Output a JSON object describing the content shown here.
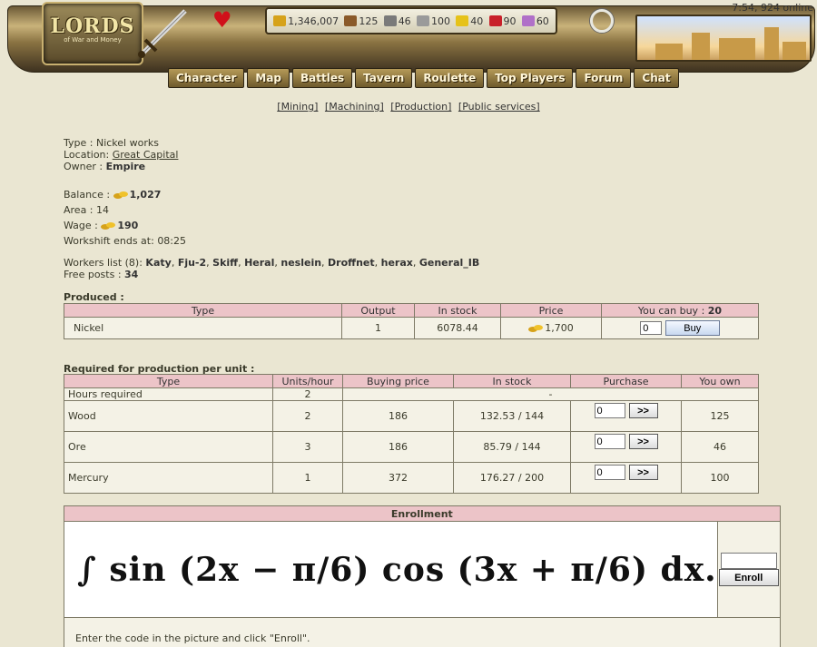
{
  "header": {
    "logo_title": "LORDS",
    "logo_subtitle": "of War and Money",
    "clock": "7:54, 924 online",
    "resources": [
      {
        "icon": "gold-icon",
        "value": "1,346,007",
        "color": "#d6a21a"
      },
      {
        "icon": "wood-icon",
        "value": "125",
        "color": "#8a5a2a"
      },
      {
        "icon": "ore-icon",
        "value": "46",
        "color": "#7a7a7a"
      },
      {
        "icon": "mercury-icon",
        "value": "100",
        "color": "#9a9a9a"
      },
      {
        "icon": "sulfur-icon",
        "value": "40",
        "color": "#e6c21a"
      },
      {
        "icon": "crystal-icon",
        "value": "90",
        "color": "#c8202a"
      },
      {
        "icon": "gems-icon",
        "value": "60",
        "color": "#b070c8"
      }
    ],
    "nav": [
      "Character",
      "Map",
      "Battles",
      "Tavern",
      "Roulette",
      "Top Players",
      "Forum",
      "Chat"
    ]
  },
  "subnav": [
    "[Mining]",
    "[Machining]",
    "[Production]",
    "[Public services]"
  ],
  "info": {
    "type_label": "Type : ",
    "type": "Nickel works",
    "location_label": "Location: ",
    "location": "Great Capital",
    "owner_label": "Owner : ",
    "owner": "Empire",
    "balance_label": "Balance : ",
    "balance": "1,027",
    "area_label": "Area : ",
    "area": "14",
    "wage_label": "Wage : ",
    "wage": "190",
    "workshift_label": "Workshift ends at: ",
    "workshift": "08:25",
    "workers_label": "Workers list (8): ",
    "workers": [
      "Katy",
      "Fju-2",
      "Skiff",
      "Heral",
      "neslein",
      "Droffnet",
      "herax",
      "General_IB"
    ],
    "free_posts_label": "Free posts : ",
    "free_posts": "34"
  },
  "produced": {
    "title": "Produced :",
    "headers": [
      "Type",
      "Output",
      "In stock",
      "Price",
      "You can buy : "
    ],
    "can_buy": "20",
    "row": {
      "type": "Nickel",
      "output": "1",
      "in_stock": "6078.44",
      "price": "1,700",
      "qty": "0",
      "buy_label": "Buy"
    }
  },
  "required": {
    "title": "Required for production per unit :",
    "headers": [
      "Type",
      "Units/hour",
      "Buying price",
      "In stock",
      "Purchase",
      "You own"
    ],
    "hours_row": {
      "type": "Hours required",
      "units": "2",
      "rest": "-"
    },
    "rows": [
      {
        "type": "Wood",
        "units": "2",
        "price": "186",
        "stock": "132.53 / 144",
        "qty": "0",
        "own": "125"
      },
      {
        "type": "Ore",
        "units": "3",
        "price": "186",
        "stock": "85.79 / 144",
        "qty": "0",
        "own": "46"
      },
      {
        "type": "Mercury",
        "units": "1",
        "price": "372",
        "stock": "176.27 / 200",
        "qty": "0",
        "own": "100"
      }
    ],
    "purchase_label": ">>"
  },
  "enrollment": {
    "title": "Enrollment",
    "captcha_text": "∫ sin (2x − π/6) cos (3x + π/6) dx.",
    "code": "",
    "button": "Enroll",
    "hint": "Enter the code in the picture and click \"Enroll\"."
  }
}
